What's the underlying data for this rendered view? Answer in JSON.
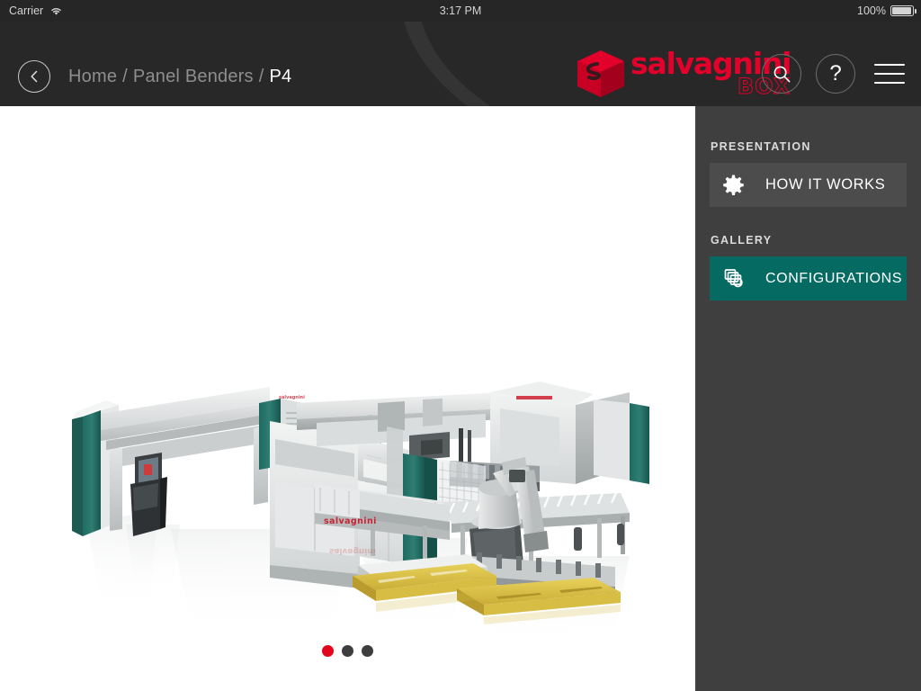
{
  "status_bar": {
    "carrier": "Carrier",
    "wifi_icon": "wifi-icon",
    "time": "3:17 PM",
    "battery_percent": "100%",
    "battery_icon": "battery-full-icon"
  },
  "header": {
    "back_icon": "chevron-left-icon",
    "breadcrumb": {
      "items": [
        "Home",
        "Panel Benders",
        "P4"
      ],
      "separator": "/",
      "current": "P4"
    },
    "logo": {
      "cube_icon": "salvagnini-cube-logo-icon",
      "wordmark": "salvagnini",
      "subtitle": "BOX",
      "color": "#e3002a"
    },
    "actions": {
      "search_icon": "search-icon",
      "help_label": "?",
      "help_icon": "help-icon",
      "menu_icon": "hamburger-menu-icon"
    },
    "background_color": "#282828"
  },
  "stage": {
    "image_alt": "Salvagnini P4 panel bender production line with robot arm and pallets",
    "background_color": "#ffffff",
    "pagination": {
      "total": 3,
      "active_index": 0,
      "active_color": "#e3051b",
      "inactive_color": "#3d3d3d"
    }
  },
  "sidebar": {
    "background_color": "#3f3f3f",
    "sections": [
      {
        "label": "PRESENTATION",
        "button": {
          "text": "HOW IT WORKS",
          "icon": "gear-icon",
          "style": "dark",
          "color": "#4c4c4c"
        }
      },
      {
        "label": "GALLERY",
        "button": {
          "text": "CONFIGURATIONS",
          "icon": "layers-gallery-icon",
          "style": "teal",
          "color": "#046a62"
        }
      }
    ]
  }
}
